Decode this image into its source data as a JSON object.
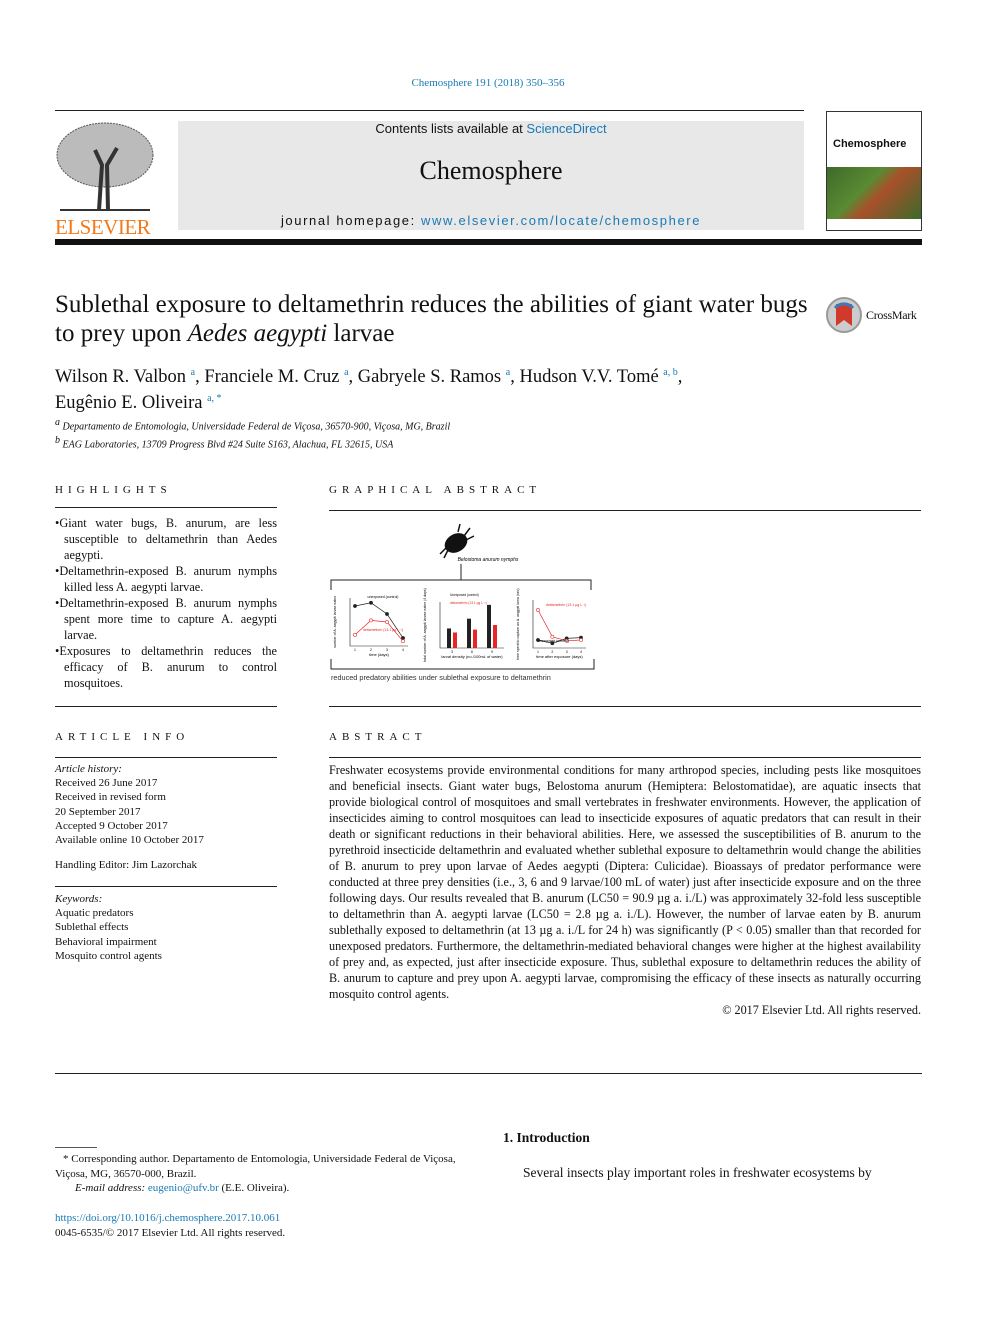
{
  "citation": "Chemosphere 191 (2018) 350–356",
  "banner": {
    "contents_prefix": "Contents lists available at ",
    "contents_link": "ScienceDirect",
    "journal": "Chemosphere",
    "homepage_prefix": "journal homepage: ",
    "homepage_link": "www.elsevier.com/locate/chemosphere"
  },
  "publisher_logo": "ELSEVIER",
  "cover_title": "Chemosphere",
  "crossmark": "CrossMark",
  "title_part1": "Sublethal exposure to deltamethrin reduces the abilities of giant water bugs to prey upon ",
  "title_italic": "Aedes aegypti",
  "title_part2": " larvae",
  "authors": [
    {
      "name": "Wilson R. Valbon",
      "sup": "a"
    },
    {
      "name": "Franciele M. Cruz",
      "sup": "a"
    },
    {
      "name": "Gabryele S. Ramos",
      "sup": "a"
    },
    {
      "name": "Hudson V.V. Tomé",
      "sup": "a, b"
    },
    {
      "name": "Eugênio E. Oliveira",
      "sup": "a, *"
    }
  ],
  "affiliations": [
    {
      "sup": "a",
      "text": "Departamento de Entomologia, Universidade Federal de Viçosa, 36570-900, Viçosa, MG, Brazil"
    },
    {
      "sup": "b",
      "text": "EAG Laboratories, 13709 Progress Blvd #24 Suite S163, Alachua, FL 32615, USA"
    }
  ],
  "highlights": {
    "heading": "HIGHLIGHTS",
    "items": [
      "Giant water bugs, B. anurum, are less susceptible to deltamethrin than Aedes aegypti.",
      "Deltamethrin-exposed B. anurum nymphs killed less A. aegypti larvae.",
      "Deltamethrin-exposed B. anurum nymphs spent more time to capture A. aegypti larvae.",
      "Exposures to deltamethrin reduces the efficacy of B. anurum to control mosquitoes."
    ]
  },
  "graphical_abstract": {
    "heading": "GRAPHICAL ABSTRACT",
    "insect_label": "Belostoma anurum nymphs",
    "caption": "reduced predatory abilities under sublethal exposure to deltamethrin",
    "panel1": {
      "ylabel": "number of A. aegypti larvae eaten",
      "xlabel": "time (days)",
      "control": "unexposed (control)",
      "treated": "deltamethrin (13.1 µg L⁻¹)",
      "x": [
        1,
        2,
        3,
        4
      ],
      "control_y": [
        25,
        27,
        20,
        5
      ],
      "treated_y": [
        7,
        16,
        15,
        3
      ],
      "ylim": [
        0,
        30
      ]
    },
    "panel2": {
      "ylabel": "total number of A. aegypti larvae eaten (4 days)",
      "xlabel": "larval density (no./100mL of water)",
      "legend_control": "Unexposed (control)",
      "legend_treated": "deltamethrin (13.1 µg L⁻¹)",
      "categories": [
        "3",
        "6",
        "9"
      ],
      "control_y": [
        34,
        51,
        75
      ],
      "treated_y": [
        27,
        32,
        40
      ],
      "ylim": [
        0,
        80
      ]
    },
    "panel3": {
      "ylabel": "time spent to capture an A. aegypti larva (sec)",
      "xlabel": "time after exposure (days)",
      "control": "unexposed (control)",
      "treated": "deltamethrin (13.1 µg L⁻¹)",
      "x": [
        1,
        2,
        3,
        4
      ],
      "control_y": [
        20,
        12,
        24,
        26
      ],
      "treated_y": [
        95,
        28,
        18,
        20
      ],
      "ylim": [
        0,
        120
      ]
    },
    "colors": {
      "control": "#222222",
      "treated": "#e8262a"
    }
  },
  "article_info": {
    "heading": "ARTICLE INFO",
    "history_label": "Article history:",
    "history": [
      "Received 26 June 2017",
      "Received in revised form",
      "20 September 2017",
      "Accepted 9 October 2017",
      "Available online 10 October 2017"
    ],
    "editor": "Handling Editor: Jim Lazorchak",
    "keywords_label": "Keywords:",
    "keywords": [
      "Aquatic predators",
      "Sublethal effects",
      "Behavioral impairment",
      "Mosquito control agents"
    ]
  },
  "abstract": {
    "heading": "ABSTRACT",
    "text": "Freshwater ecosystems provide environmental conditions for many arthropod species, including pests like mosquitoes and beneficial insects. Giant water bugs, Belostoma anurum (Hemiptera: Belostomatidae), are aquatic insects that provide biological control of mosquitoes and small vertebrates in freshwater environments. However, the application of insecticides aiming to control mosquitoes can lead to insecticide exposures of aquatic predators that can result in their death or significant reductions in their behavioral abilities. Here, we assessed the susceptibilities of B. anurum to the pyrethroid insecticide deltamethrin and evaluated whether sublethal exposure to deltamethrin would change the abilities of B. anurum to prey upon larvae of Aedes aegypti (Diptera: Culicidae). Bioassays of predator performance were conducted at three prey densities (i.e., 3, 6 and 9 larvae/100 mL of water) just after insecticide exposure and on the three following days. Our results revealed that B. anurum (LC50 = 90.9 µg a. i./L) was approximately 32-fold less susceptible to deltamethrin than A. aegypti larvae (LC50 = 2.8 µg a. i./L). However, the number of larvae eaten by B. anurum sublethally exposed to deltamethrin (at 13 µg a. i./L for 24 h) was significantly (P < 0.05) smaller than that recorded for unexposed predators. Furthermore, the deltamethrin-mediated behavioral changes were higher at the highest availability of prey and, as expected, just after insecticide exposure. Thus, sublethal exposure to deltamethrin reduces the ability of B. anurum to capture and prey upon A. aegypti larvae, compromising the efficacy of these insects as naturally occurring mosquito control agents.",
    "copyright": "© 2017 Elsevier Ltd. All rights reserved."
  },
  "footnote": {
    "corresponding": "* Corresponding author. Departamento de Entomologia, Universidade Federal de Viçosa, Viçosa, MG, 36570-000, Brazil.",
    "email_label": "E-mail address: ",
    "email": "eugenio@ufv.br",
    "email_suffix": " (E.E. Oliveira).",
    "doi": "https://doi.org/10.1016/j.chemosphere.2017.10.061",
    "issn": "0045-6535/© 2017 Elsevier Ltd. All rights reserved."
  },
  "intro": {
    "heading": "1.  Introduction",
    "first_line": "Several insects play important roles in freshwater ecosystems by"
  }
}
